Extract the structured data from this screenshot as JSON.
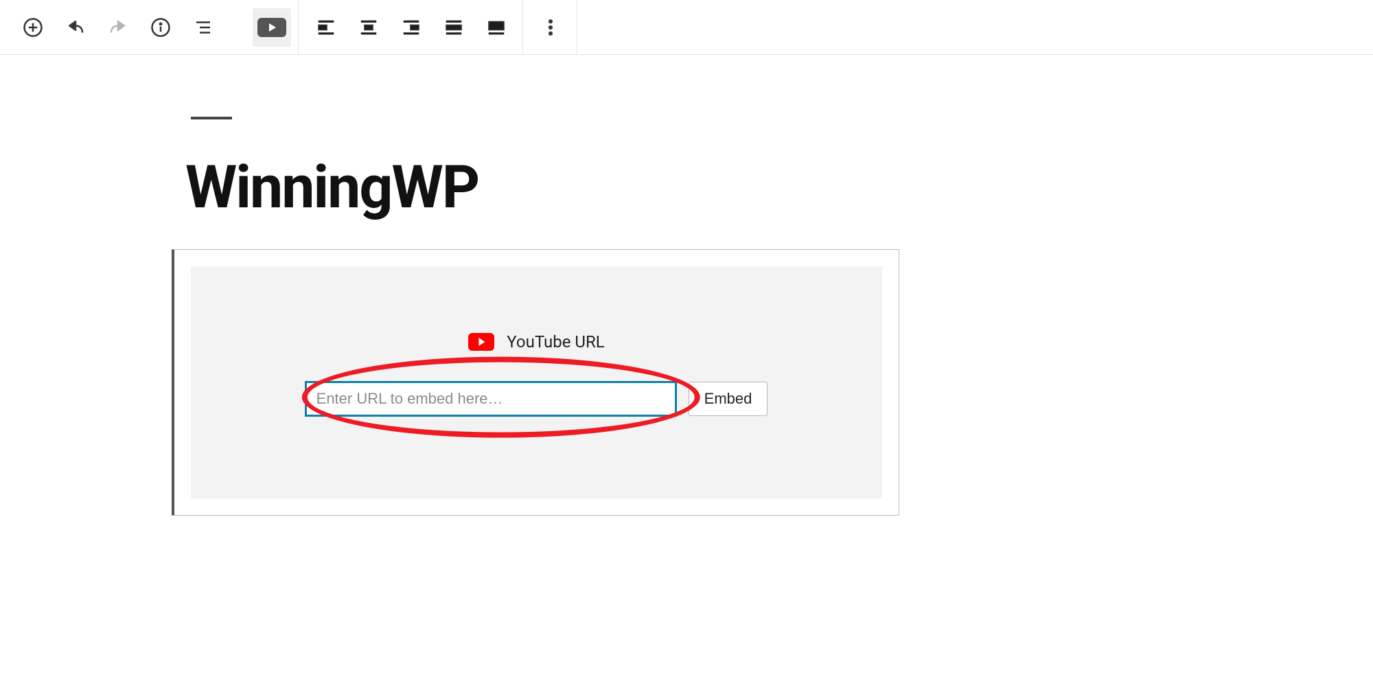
{
  "toolbar": {
    "add_block_label": "Add block",
    "undo_label": "Undo",
    "redo_label": "Redo",
    "info_label": "Content structure",
    "outline_label": "Block navigation",
    "block_type_label": "YouTube",
    "align_left_label": "Align left",
    "align_center_label": "Align center",
    "align_right_label": "Align right",
    "align_wide_label": "Wide width",
    "align_full_label": "Full width",
    "more_label": "More options"
  },
  "post": {
    "title": "WinningWP"
  },
  "embed": {
    "label": "YouTube URL",
    "placeholder": "Enter URL to embed here…",
    "button_label": "Embed"
  }
}
